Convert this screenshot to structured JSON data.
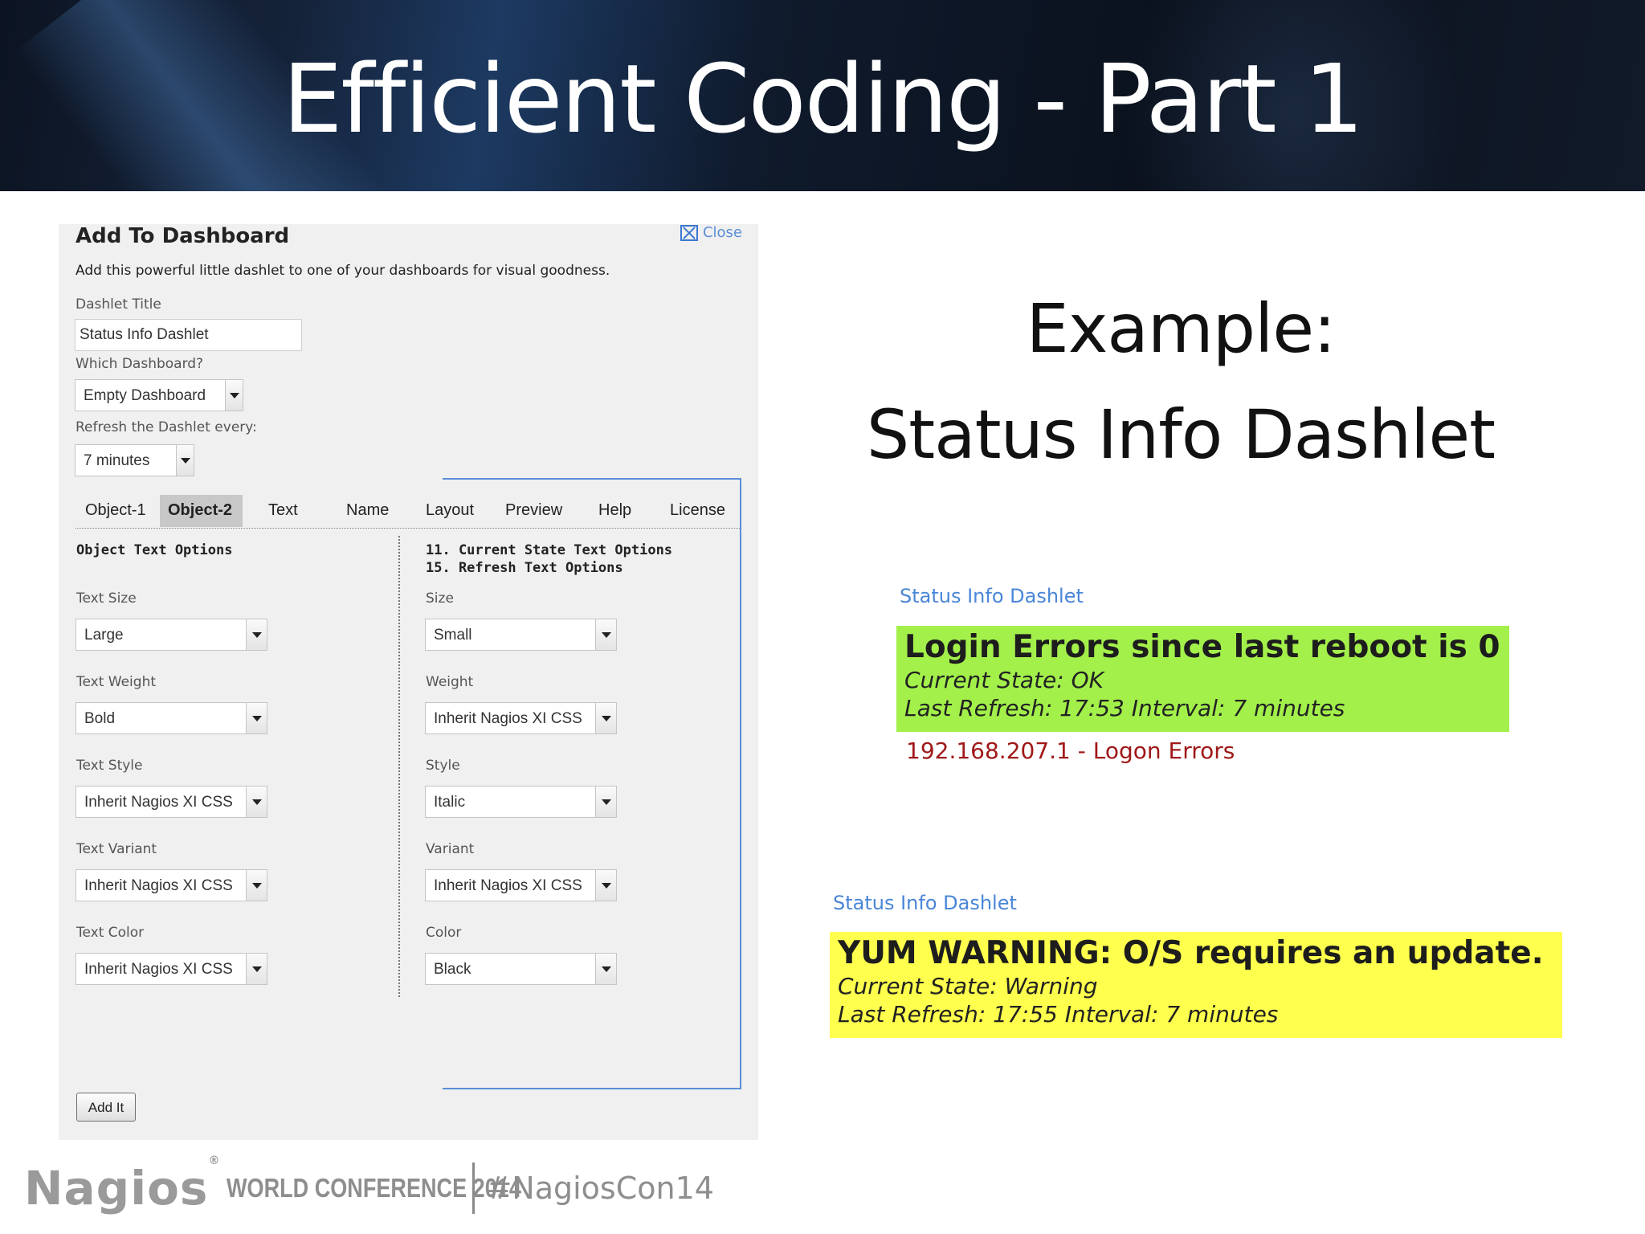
{
  "slide": {
    "title": "Efficient Coding - Part 1",
    "example_line1": "Example:",
    "example_line2": "Status Info Dashlet"
  },
  "dialog": {
    "title": "Add To Dashboard",
    "close_label": "Close",
    "description": "Add this powerful little dashlet to one of your dashboards for visual goodness.",
    "dashlet_title_label": "Dashlet Title",
    "dashlet_title_value": "Status Info Dashlet",
    "which_dashboard_label": "Which Dashboard?",
    "which_dashboard_value": "Empty Dashboard",
    "refresh_label": "Refresh the Dashlet every:",
    "refresh_value": "7 minutes",
    "tabs": [
      "Object-1",
      "Object-2",
      "Text",
      "Name",
      "Layout",
      "Preview",
      "Help",
      "License"
    ],
    "active_tab": "Object-2",
    "left_section": {
      "heading": "Object Text Options",
      "fields": [
        {
          "label": "Text Size",
          "value": "Large"
        },
        {
          "label": "Text Weight",
          "value": "Bold"
        },
        {
          "label": "Text Style",
          "value": "Inherit Nagios XI CSS"
        },
        {
          "label": "Text Variant",
          "value": "Inherit Nagios XI CSS"
        },
        {
          "label": "Text Color",
          "value": "Inherit Nagios XI CSS"
        }
      ]
    },
    "right_section": {
      "heading_line1": "11. Current State Text Options",
      "heading_line2": "15. Refresh Text Options",
      "fields": [
        {
          "label": "Size",
          "value": "Small"
        },
        {
          "label": "Weight",
          "value": "Inherit Nagios XI CSS"
        },
        {
          "label": "Style",
          "value": "Italic"
        },
        {
          "label": "Variant",
          "value": "Inherit Nagios XI CSS"
        },
        {
          "label": "Color",
          "value": "Black"
        }
      ]
    },
    "add_button": "Add It"
  },
  "dashlets": [
    {
      "title": "Status Info Dashlet",
      "headline": "Login Errors since last reboot is 0",
      "state": "Current State: OK",
      "refresh": "Last Refresh: 17:53 Interval: 7 minutes",
      "link": "192.168.207.1 - Logon Errors",
      "color": "#a3f04b"
    },
    {
      "title": "Status Info Dashlet",
      "headline": "YUM WARNING: O/S requires an update.",
      "state": "Current State: Warning",
      "refresh": "Last Refresh: 17:55 Interval: 7 minutes",
      "color": "#ffff4d"
    }
  ],
  "footer": {
    "logo": "Nagios",
    "registered": "®",
    "conference": "WORLD CONFERENCE 2014",
    "hashtag": "#NagiosCon14"
  }
}
